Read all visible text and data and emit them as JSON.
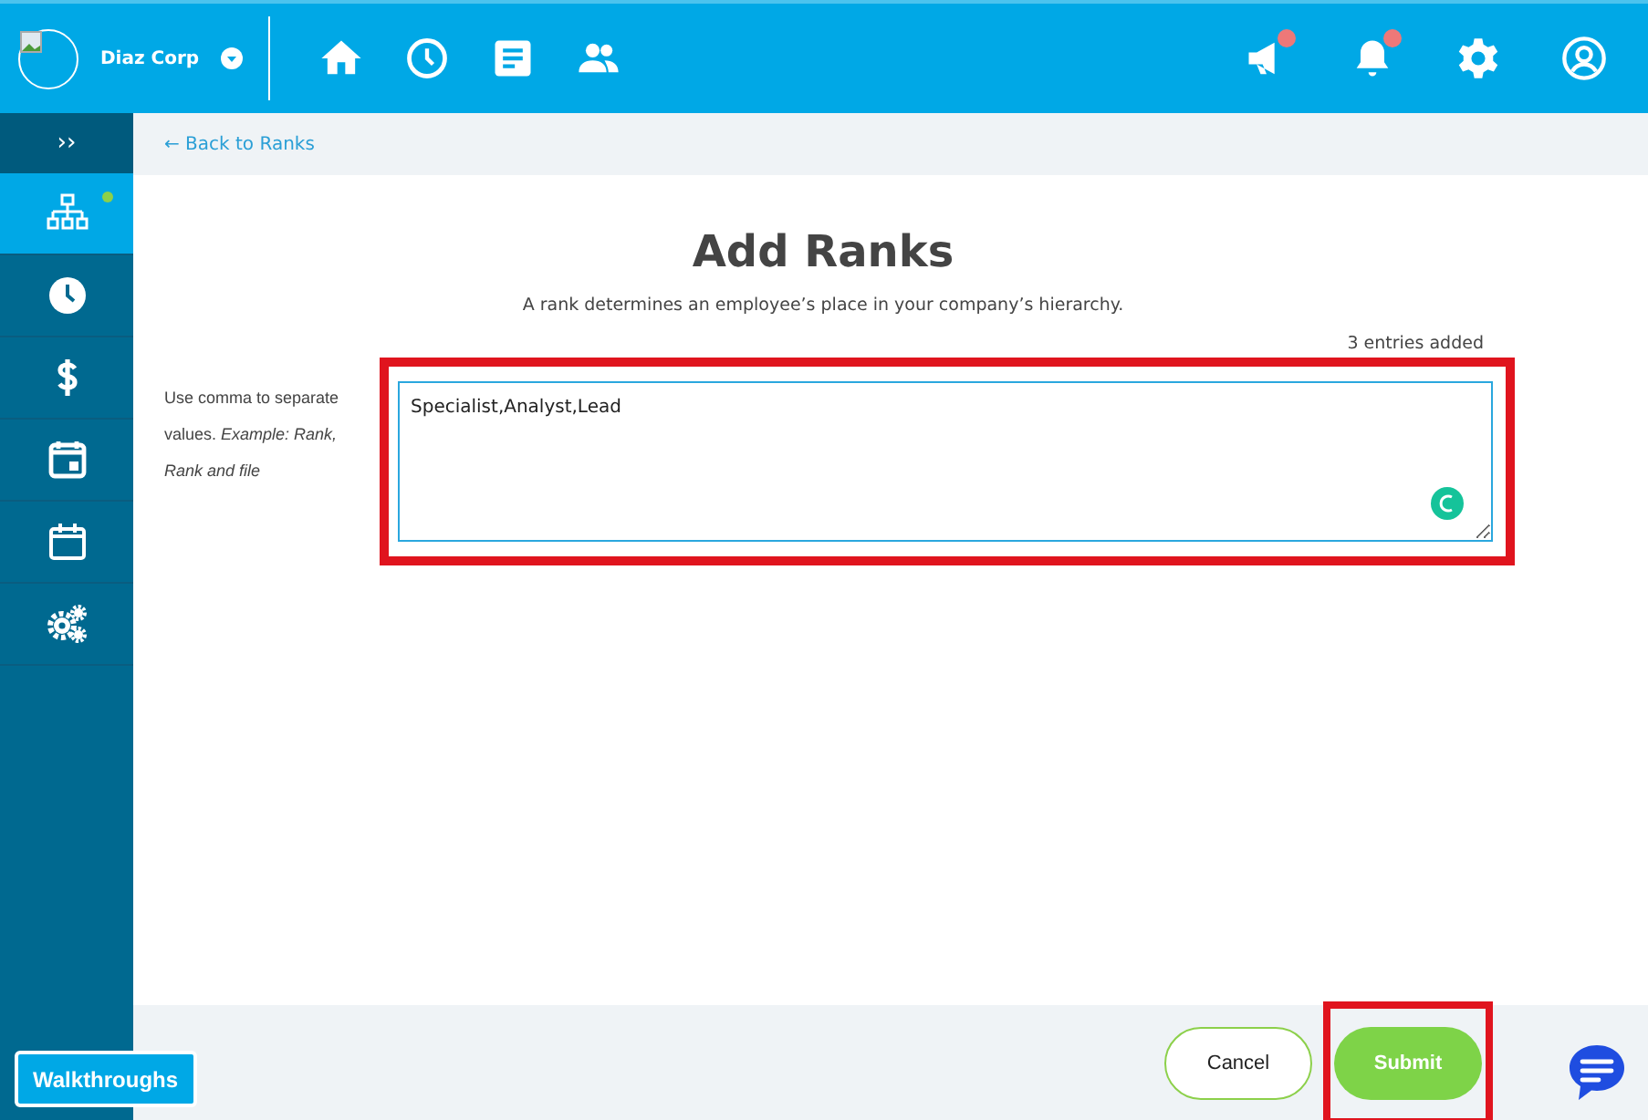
{
  "header": {
    "company": "Diaz Corp",
    "nav": [
      {
        "kind": "home"
      },
      {
        "kind": "clock"
      },
      {
        "kind": "document"
      },
      {
        "kind": "people"
      }
    ],
    "actions": [
      {
        "kind": "megaphone",
        "badge": true
      },
      {
        "kind": "bell",
        "badge": true
      },
      {
        "kind": "settings",
        "badge": false
      },
      {
        "kind": "user",
        "badge": false
      }
    ]
  },
  "sidebar": {
    "toggle": "››",
    "items": [
      {
        "kind": "org",
        "selected": true,
        "dot": true
      },
      {
        "kind": "clock",
        "selected": false,
        "dot": false
      },
      {
        "kind": "dollar",
        "selected": false,
        "dot": false
      },
      {
        "kind": "calendar-day",
        "selected": false,
        "dot": false
      },
      {
        "kind": "calendar",
        "selected": false,
        "dot": false
      },
      {
        "kind": "gears",
        "selected": false,
        "dot": false
      }
    ]
  },
  "back_link": "← Back to Ranks",
  "title": "Add Ranks",
  "subtitle": "A rank determines an employee’s place in your company’s hierarchy.",
  "counter": "3 entries added",
  "hint": "Use comma to separate values. *Example: Rank, Rank and file*",
  "ranks_field": {
    "value": "Specialist,Analyst,Lead",
    "highlighted": true
  },
  "buttons": [
    {
      "label": "Cancel",
      "kind": "secondary",
      "highlighted": false
    },
    {
      "label": "Submit",
      "kind": "primary",
      "highlighted": true
    }
  ],
  "walkthroughs": "Walkthroughs"
}
